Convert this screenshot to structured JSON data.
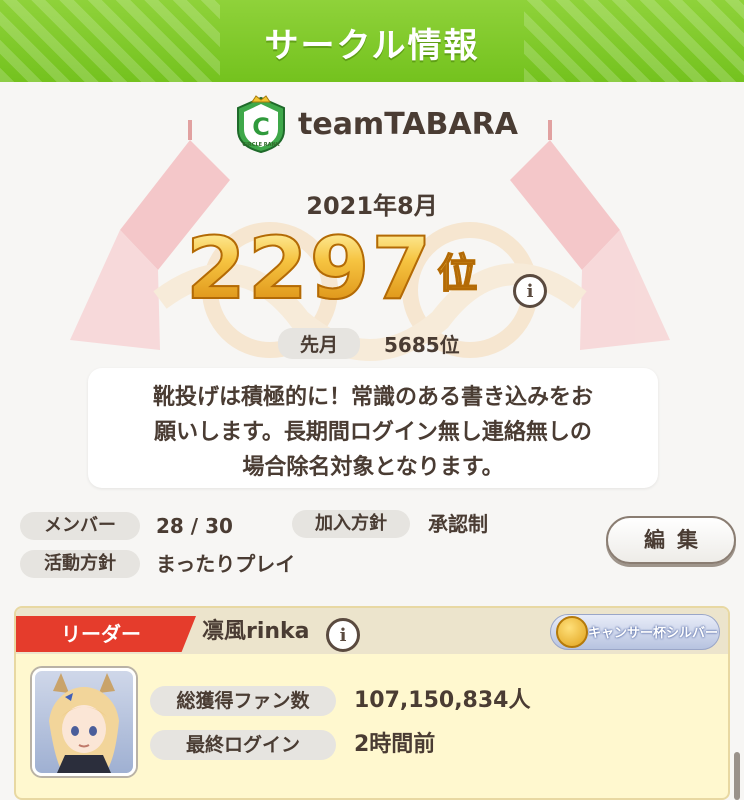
{
  "header": {
    "title": "サークル情報"
  },
  "circle": {
    "name": "teamTABARA",
    "emblem_text": "CIRCLE RANK",
    "emblem_letter": "C",
    "month": "2021年8月",
    "rank": "2297",
    "rank_suffix": "位",
    "info_symbol": "i",
    "prev_label": "先月",
    "prev_rank": "5685位",
    "description_lines": [
      "靴投げは積極的に！常識のある書き込みをお",
      "願いします。長期間ログイン無し連絡無しの",
      "場合除名対象となります。"
    ]
  },
  "details": {
    "members_label": "メンバー",
    "members_value": "28 / 30",
    "join_label": "加入方針",
    "join_value": "承認制",
    "activity_label": "活動方針",
    "activity_value": "まったりプレイ",
    "edit_label": "編集"
  },
  "leader": {
    "tab_label": "リーダー",
    "name": "凛風rinka",
    "info_symbol": "i",
    "badge_text": "キャンサー杯シルバー",
    "fans_label": "総獲得ファン数",
    "fans_value": "107,150,834人",
    "login_label": "最終ログイン",
    "login_value": "2時間前"
  },
  "colors": {
    "header_green": "#7cc623",
    "leader_red": "#e53c2c",
    "gold": "#f6c441",
    "text_brown": "#4a3c33"
  }
}
